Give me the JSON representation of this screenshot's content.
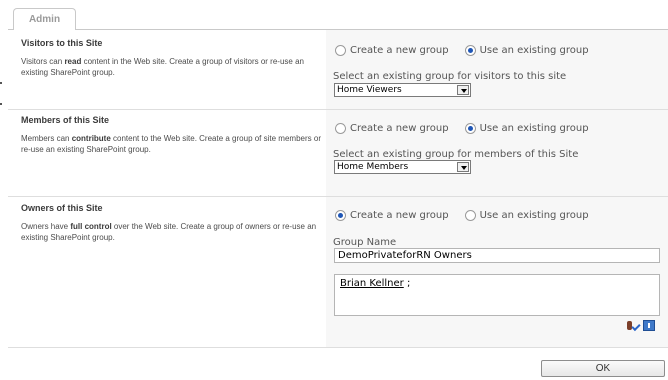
{
  "tabs": [
    {
      "label": "Admin"
    }
  ],
  "visitors": {
    "title": "Visitors to this Site",
    "desc_before": "Visitors can ",
    "desc_bold": "read",
    "desc_after": " content in the Web site. Create a group of visitors or re-use an existing SharePoint group.",
    "radio_new_label": "Create a new group",
    "radio_existing_label": "Use an existing group",
    "selected_option": "Use an existing group",
    "select_label": "Select an existing group for visitors to this site",
    "select_value": "Home Viewers"
  },
  "members": {
    "title": "Members of this Site",
    "desc_before": "Members can ",
    "desc_bold": "contribute",
    "desc_after": " content to the Web site. Create a group of site members or re-use an existing SharePoint group.",
    "radio_new_label": "Create a new group",
    "radio_existing_label": "Use an existing group",
    "selected_option": "Use an existing group",
    "select_label": "Select an existing group for members of this Site",
    "select_value": "Home Members"
  },
  "owners": {
    "title": "Owners of this Site",
    "desc_before": "Owners have ",
    "desc_bold": "full control",
    "desc_after": " over the Web site. Create a group of owners or re-use an existing SharePoint group.",
    "radio_new_label": "Create a new group",
    "radio_existing_label": "Use an existing group",
    "selected_option": "Create a new group",
    "group_name_label": "Group Name",
    "group_name_value": "DemoPrivateforRN Owners",
    "people": [
      {
        "name": "Brian Kellner",
        "separator": " ;"
      }
    ]
  },
  "icons": {
    "check_names": "check-names-icon",
    "browse": "address-book-icon"
  },
  "accent": "#1f56b6",
  "footer": {
    "ok_label": "OK"
  }
}
